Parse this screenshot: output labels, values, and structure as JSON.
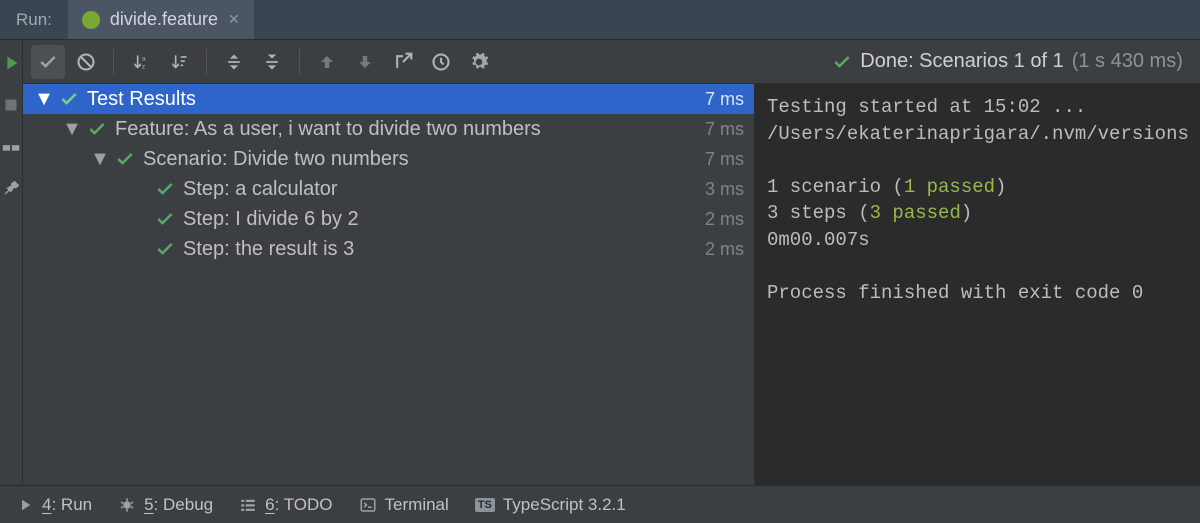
{
  "header": {
    "run_label": "Run:",
    "tab": {
      "filename": "divide.feature"
    }
  },
  "status": {
    "text": "Done: Scenarios 1 of 1",
    "timing": "(1 s 430 ms)"
  },
  "tree": {
    "root": {
      "label": "Test Results",
      "duration": "7 ms"
    },
    "feature": {
      "label": "Feature: As a user, i want to divide two numbers",
      "duration": "7 ms"
    },
    "scenario": {
      "label": "Scenario: Divide two numbers",
      "duration": "7 ms"
    },
    "steps": [
      {
        "label": "Step: a calculator",
        "duration": "3 ms"
      },
      {
        "label": "Step: I divide 6 by 2",
        "duration": "2 ms"
      },
      {
        "label": "Step: the result is 3",
        "duration": "2 ms"
      }
    ]
  },
  "console": {
    "line1": "Testing started at 15:02 ...",
    "line2": "/Users/ekaterinaprigara/.nvm/versions",
    "scenario_prefix": "1 scenario (",
    "scenario_passed": "1 passed",
    "scenario_suffix": ")",
    "steps_prefix": "3 steps (",
    "steps_passed": "3 passed",
    "steps_suffix": ")",
    "time": "0m00.007s",
    "exit": "Process finished with exit code 0"
  },
  "bottom": {
    "run": {
      "key": "4",
      "label": ": Run"
    },
    "debug": {
      "key": "5",
      "label": ": Debug"
    },
    "todo": {
      "key": "6",
      "label": ": TODO"
    },
    "terminal": "Terminal",
    "typescript": "TypeScript 3.2.1"
  }
}
